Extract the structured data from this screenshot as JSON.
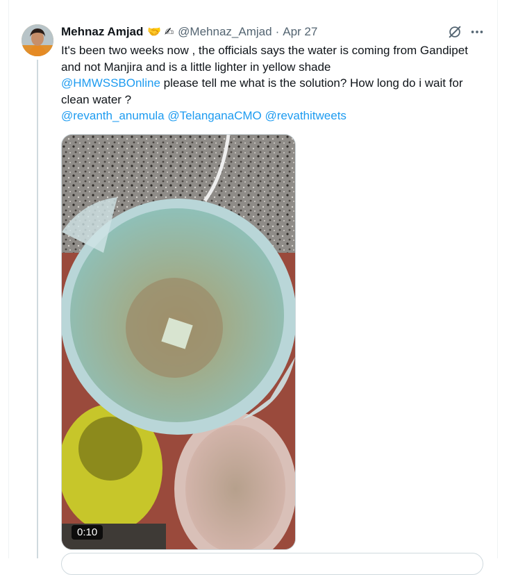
{
  "tweet": {
    "author_name": "Mehnaz Amjad",
    "author_emojis": "🤝 ✍",
    "handle": "@Mehnaz_Amjad",
    "separator": "·",
    "date": "Apr 27",
    "text_line": "It's been two weeks now , the officials says the water is coming from Gandipet and not Manjira and is a little lighter in yellow shade",
    "mention_primary": "@HMWSSBOnline",
    "text_after_mention": " please tell me what is the solution? How long do i wait for clean water ?",
    "mentions": [
      "@revanth_anumula",
      "@TelanganaCMO",
      "@revathitweets"
    ],
    "media": {
      "type": "video",
      "duration": "0:10"
    }
  },
  "icons": {
    "grok": "grok-icon",
    "more": "more-options-icon"
  },
  "colors": {
    "link": "#1d9bf0",
    "secondary_text": "#536471",
    "border": "#cfd9de"
  }
}
